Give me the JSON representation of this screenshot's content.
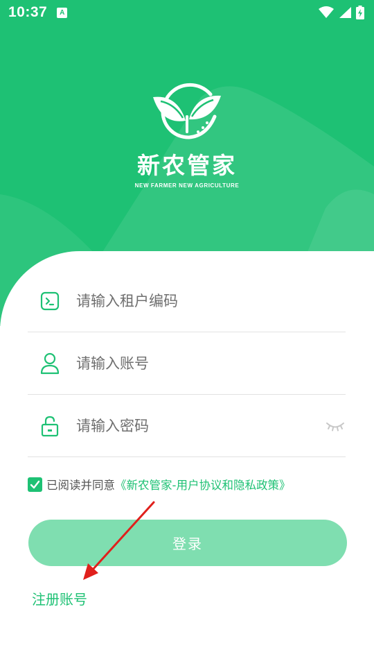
{
  "status_bar": {
    "time": "10:37",
    "app_icon_letter": "A",
    "icons": [
      "wifi-icon",
      "cell-signal-icon",
      "battery-charging-icon"
    ]
  },
  "logo": {
    "name": "新农管家",
    "tagline": "NEW FARMER NEW AGRICULTURE"
  },
  "form": {
    "tenant_placeholder": "请输入租户编码",
    "account_placeholder": "请输入账号",
    "password_placeholder": "请输入密码"
  },
  "agreement": {
    "checked": true,
    "prefix": "已阅读并同意",
    "link": "《新农管家-用户协议和隐私政策》"
  },
  "buttons": {
    "login": "登录",
    "register": "注册账号"
  },
  "colors": {
    "brand_green": "#1ec174",
    "button_green_disabled": "#7fdeb0",
    "annotation_red": "#e0201c"
  }
}
